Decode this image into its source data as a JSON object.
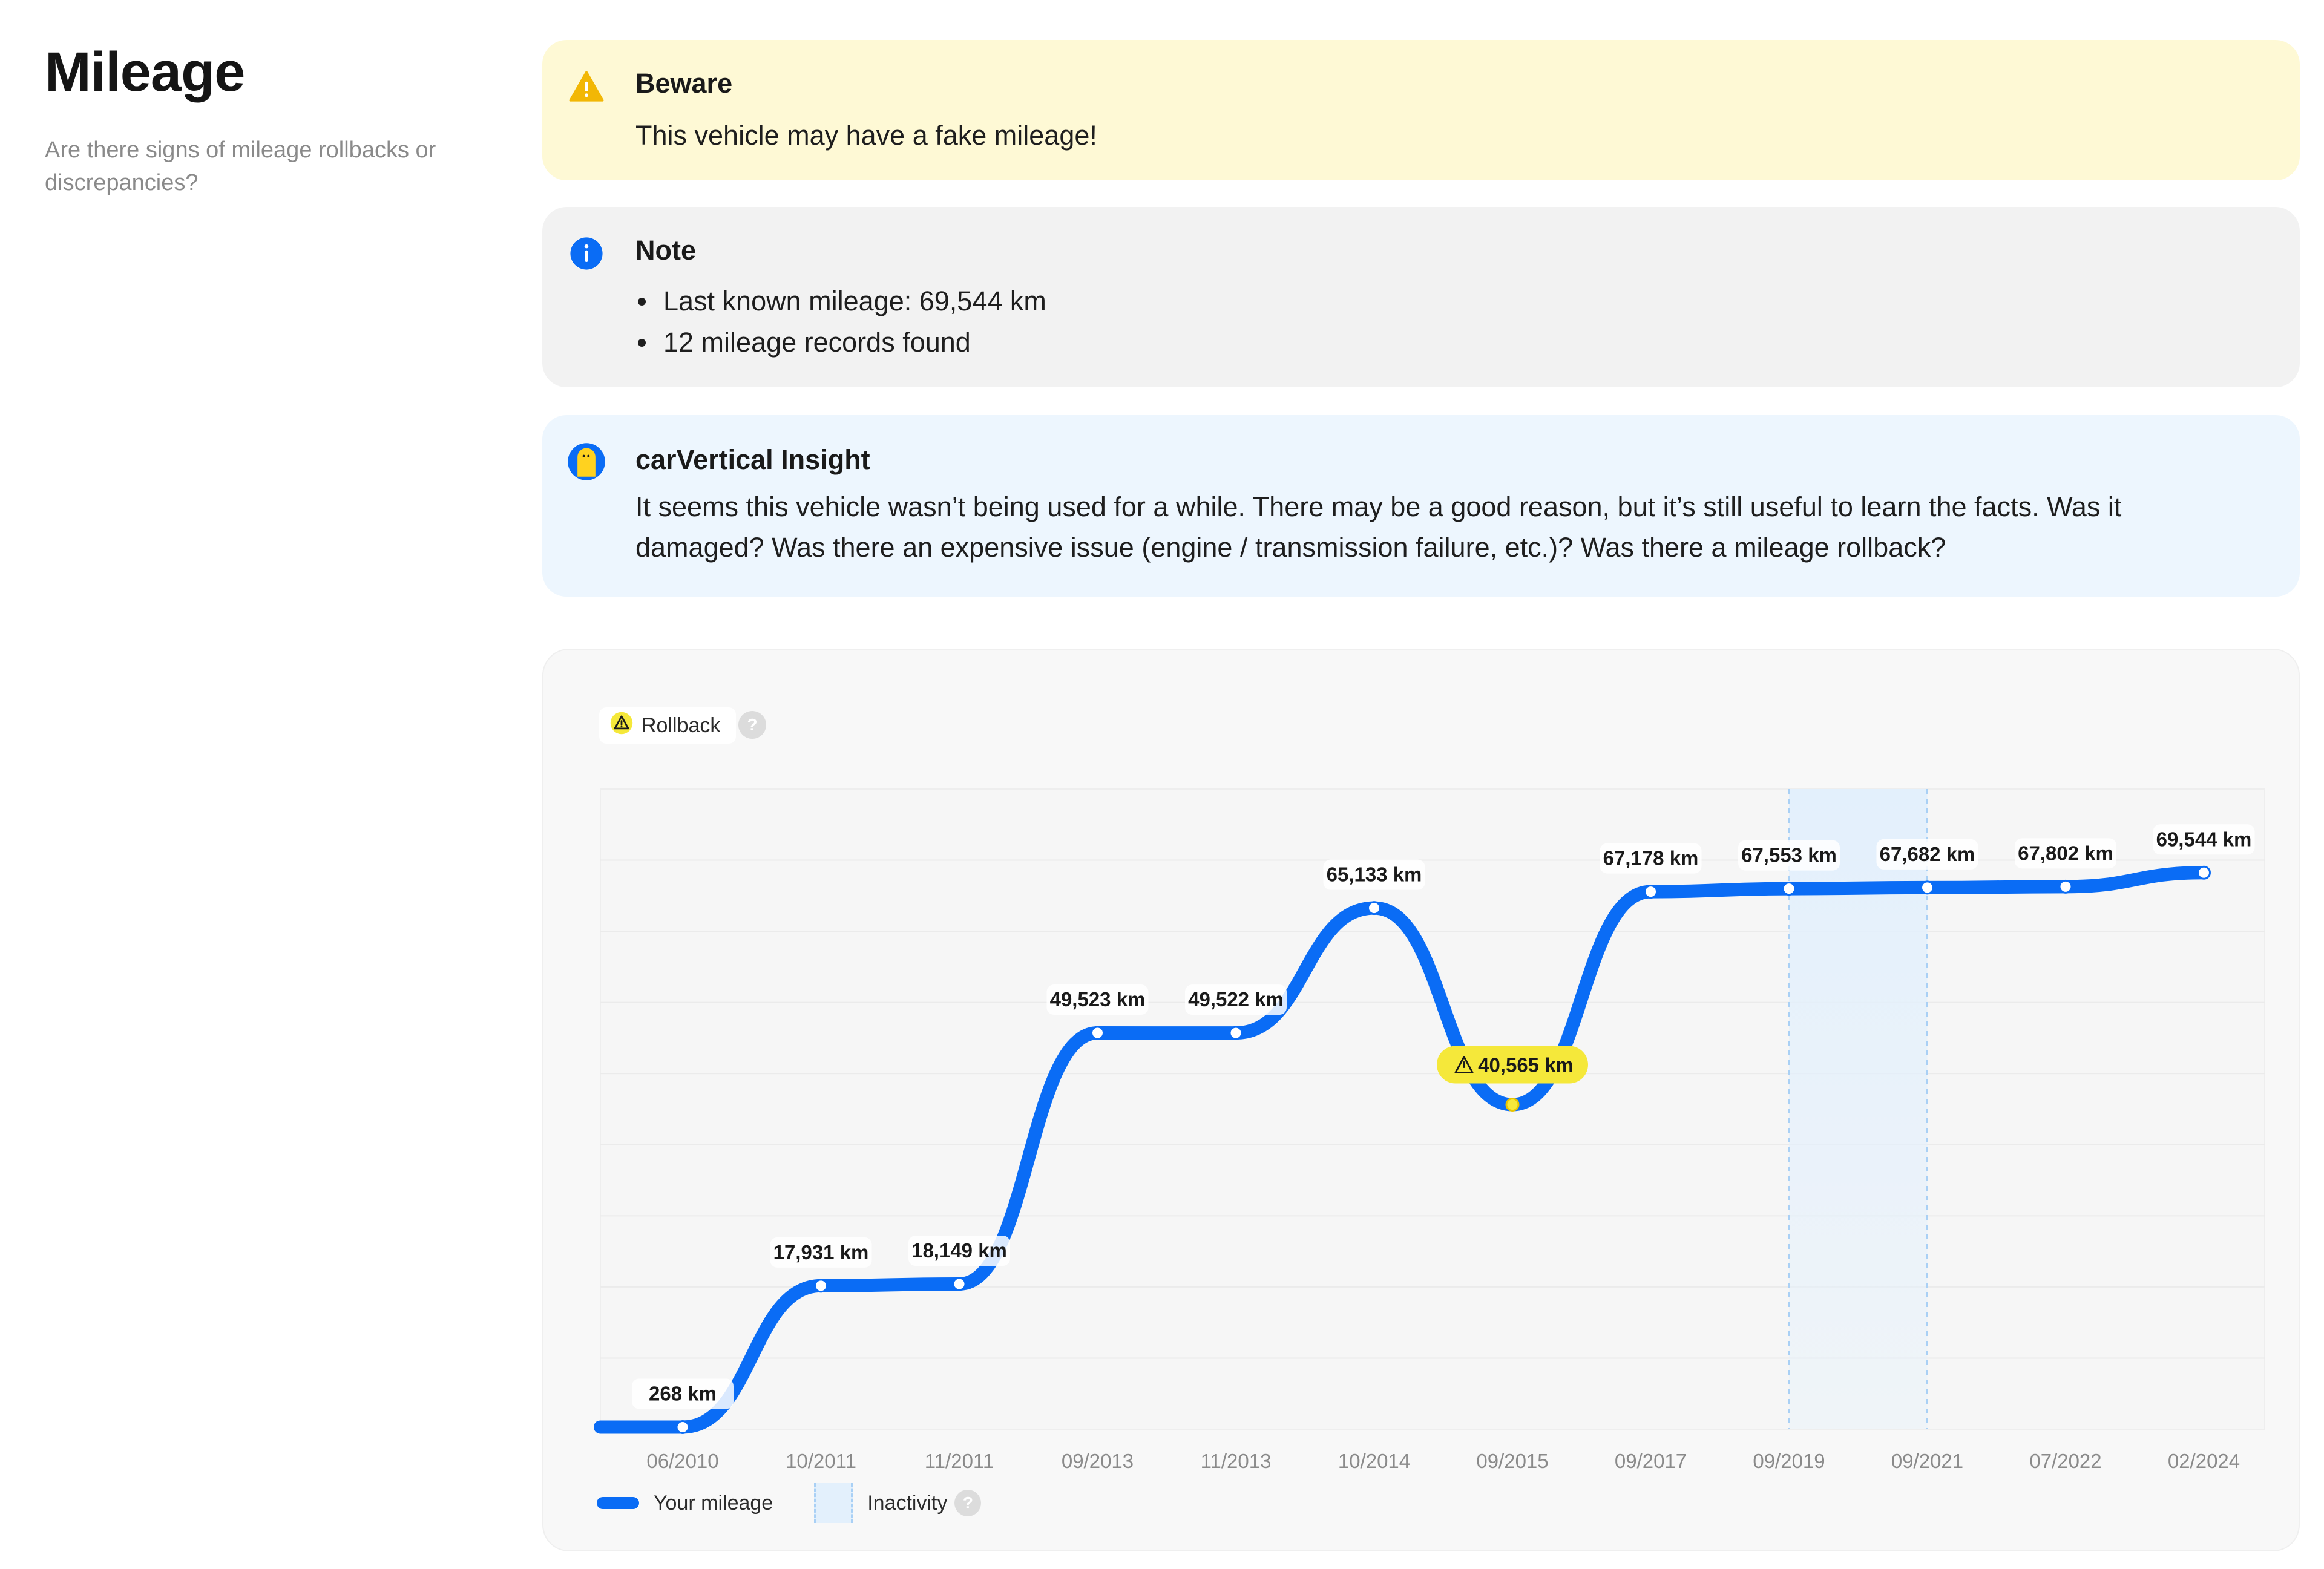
{
  "section": {
    "title": "Mileage",
    "subtitle": "Are there signs of mileage rollbacks or discrepancies?"
  },
  "beware": {
    "title": "Beware",
    "message": "This vehicle may have a fake mileage!",
    "icon": "warning-triangle-icon",
    "color": "#f2b705"
  },
  "note": {
    "title": "Note",
    "items": [
      "Last known mileage: 69,544 km",
      "12 mileage records found"
    ],
    "icon": "info-icon",
    "color": "#0a6cf5"
  },
  "insight": {
    "title": "carVertical Insight",
    "body": "It seems this vehicle wasn’t being used for a while. There may be a good reason, but it’s still useful to learn the facts. Was it damaged? Was there an expensive issue (engine / transmission failure, etc.)? Was there a mileage rollback?",
    "icon": "carvertical-mascot-icon"
  },
  "chart": {
    "rollback_label": "Rollback",
    "help_glyph": "?",
    "legend": {
      "your_mileage": "Your mileage",
      "inactivity": "Inactivity"
    },
    "colors": {
      "line": "#0a6cf5",
      "rollback": "#f5e83a",
      "inactivity": "#e3f0fc"
    }
  },
  "chart_data": {
    "type": "line",
    "categories": [
      "06/2010",
      "10/2011",
      "11/2011",
      "09/2013",
      "11/2013",
      "10/2014",
      "09/2015",
      "09/2017",
      "09/2019",
      "09/2021",
      "07/2022",
      "02/2024"
    ],
    "series": [
      {
        "name": "Your mileage",
        "values": [
          268,
          17931,
          18149,
          49523,
          49522,
          65133,
          40565,
          67178,
          67553,
          67682,
          67802,
          69544
        ]
      }
    ],
    "labels": [
      "268 km",
      "17,931 km",
      "18,149 km",
      "49,523 km",
      "49,522 km",
      "65,133 km",
      "40,565 km",
      "67,178 km",
      "67,553 km",
      "67,682 km",
      "67,802 km",
      "69,544 km"
    ],
    "rollback_points": [
      6
    ],
    "inactivity_period": [
      "09/2019",
      "09/2021"
    ],
    "ylim": [
      0,
      80000
    ],
    "grid": true,
    "legend_position": "bottom-left"
  }
}
